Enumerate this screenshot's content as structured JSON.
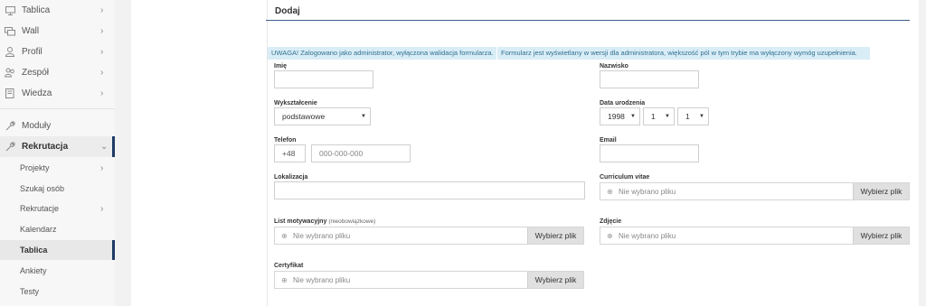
{
  "sidebar": {
    "items": [
      {
        "label": "Tablica",
        "icon": "monitor-icon"
      },
      {
        "label": "Wall",
        "icon": "chat-icon"
      },
      {
        "label": "Profil",
        "icon": "user-icon"
      },
      {
        "label": "Zespół",
        "icon": "team-icon"
      },
      {
        "label": "Wiedza",
        "icon": "book-icon"
      },
      {
        "label": "Moduły",
        "icon": "wrench-icon"
      },
      {
        "label": "Rekrutacja",
        "icon": "wrench-icon"
      }
    ],
    "subitems": [
      {
        "label": "Projekty"
      },
      {
        "label": "Szukaj osób"
      },
      {
        "label": "Rekrutacje"
      },
      {
        "label": "Kalendarz"
      },
      {
        "label": "Tablica"
      },
      {
        "label": "Ankiety"
      },
      {
        "label": "Testy"
      }
    ],
    "accent": "#1f3b64"
  },
  "form": {
    "title": "Dodaj",
    "warning_admin": "UWAGA! Zalogowano jako administrator, wyłączona walidacja formularza.",
    "warning_required": "Formularz jest wyświetlany w wersji dla administratora, większość pól w tym trybie ma wyłączony wymóg uzupełnienia.",
    "labels": {
      "first_name": "Imię",
      "last_name": "Nazwisko",
      "education": "Wykształcenie",
      "birth_date": "Data urodzenia",
      "phone": "Telefon",
      "email": "Email",
      "location": "Lokalizacja",
      "cv": "Curriculum vitae",
      "cover_letter": "List motywacyjny",
      "cover_letter_optional": "(nieobowiązkowe)",
      "photo": "Zdjęcie",
      "certificate": "Certyfikat"
    },
    "values": {
      "education": "podstawowe",
      "birth_year": "1998",
      "birth_month": "1",
      "birth_day": "1",
      "phone_prefix": "+48",
      "phone_placeholder": "000-000-000"
    },
    "file": {
      "no_file": "Nie wybrano pliku",
      "choose_button": "Wybierz plik"
    }
  }
}
